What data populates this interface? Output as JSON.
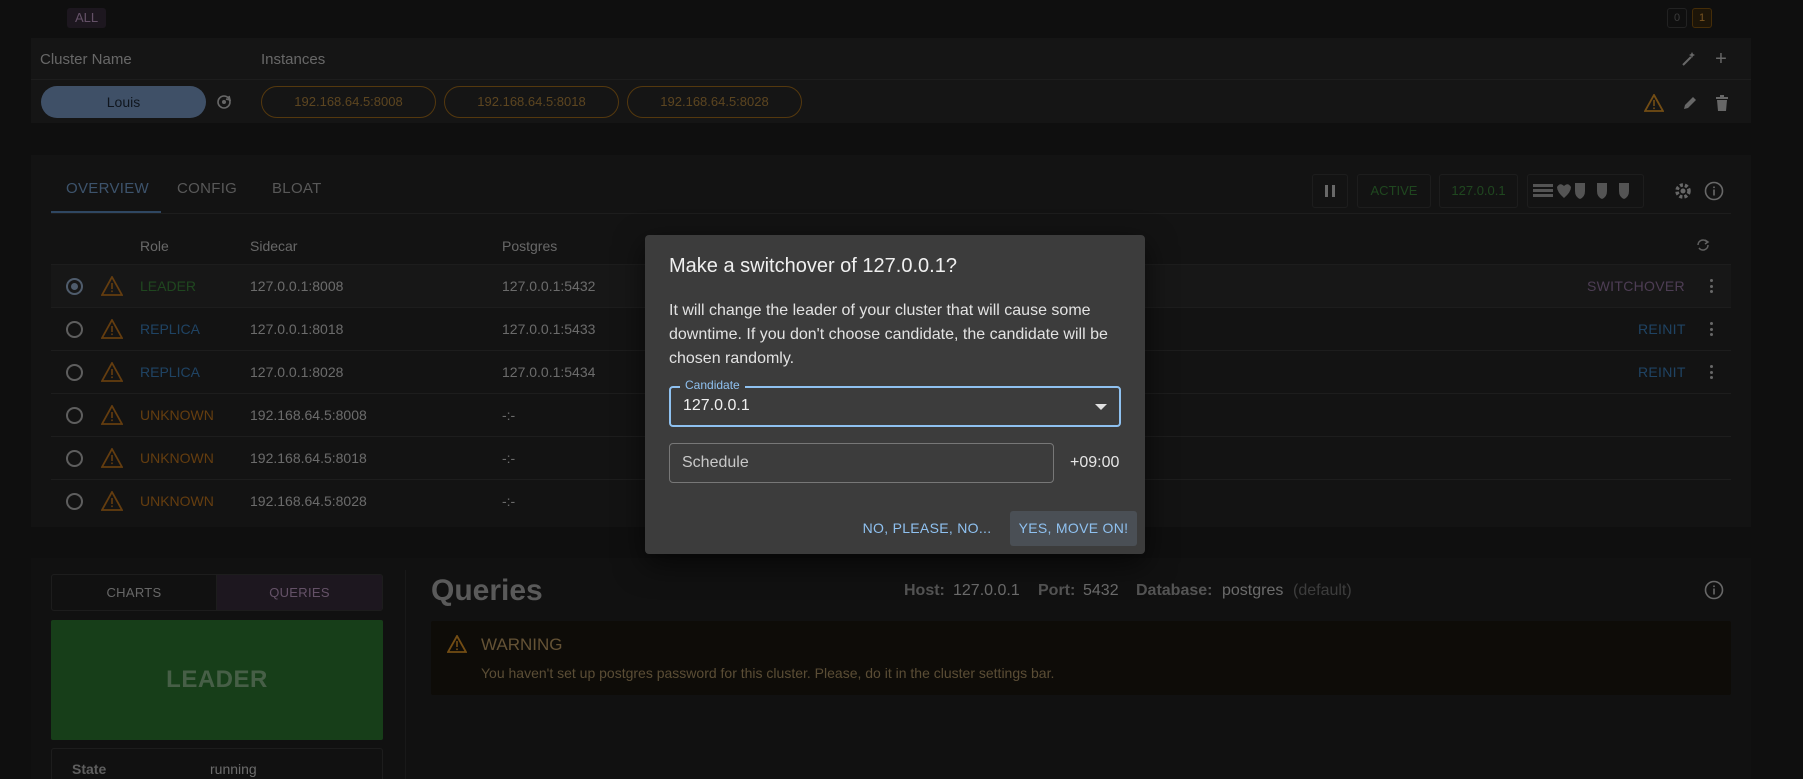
{
  "top": {
    "filter_tag": "ALL",
    "count_a": "0",
    "count_b": "1"
  },
  "clusters": {
    "headers": {
      "name": "Cluster Name",
      "instances": "Instances"
    },
    "row": {
      "name": "Louis",
      "instances": [
        "192.168.64.5:8008",
        "192.168.64.5:8018",
        "192.168.64.5:8028"
      ]
    }
  },
  "panel": {
    "tabs": [
      "OVERVIEW",
      "CONFIG",
      "BLOAT"
    ],
    "active_tab": "OVERVIEW",
    "status": "ACTIVE",
    "host": "127.0.0.1",
    "columns": {
      "role": "Role",
      "sidecar": "Sidecar",
      "postgres": "Postgres"
    },
    "rows": [
      {
        "role": "LEADER",
        "sidecar": "127.0.0.1:8008",
        "postgres": "127.0.0.1:5432",
        "action": "SWITCHOVER",
        "selected": true
      },
      {
        "role": "REPLICA",
        "sidecar": "127.0.0.1:8018",
        "postgres": "127.0.0.1:5433",
        "action": "REINIT"
      },
      {
        "role": "REPLICA",
        "sidecar": "127.0.0.1:8028",
        "postgres": "127.0.0.1:5434",
        "action": "REINIT"
      },
      {
        "role": "UNKNOWN",
        "sidecar": "192.168.64.5:8008",
        "postgres": "-:-",
        "action": ""
      },
      {
        "role": "UNKNOWN",
        "sidecar": "192.168.64.5:8018",
        "postgres": "-:-",
        "action": ""
      },
      {
        "role": "UNKNOWN",
        "sidecar": "192.168.64.5:8028",
        "postgres": "-:-",
        "action": ""
      }
    ]
  },
  "bottom": {
    "side_tabs": [
      "CHARTS",
      "QUERIES"
    ],
    "active_side_tab": "QUERIES",
    "role_box": "LEADER",
    "state_label": "State",
    "state_value": "running",
    "title": "Queries",
    "host_label": "Host:",
    "host_value": "127.0.0.1",
    "port_label": "Port:",
    "port_value": "5432",
    "db_label": "Database:",
    "db_value": "postgres",
    "db_note": "(default)",
    "warning_title": "WARNING",
    "warning_text": "You haven't set up postgres password for this cluster. Please, do it in the cluster settings bar."
  },
  "dialog": {
    "title": "Make a switchover of 127.0.0.1?",
    "body": "It will change the leader of your cluster that will cause some downtime. If you don't choose candidate, the candidate will be chosen randomly.",
    "candidate_label": "Candidate",
    "candidate_value": "127.0.0.1",
    "schedule_placeholder": "Schedule",
    "timezone": "+09:00",
    "cancel": "NO, PLEASE, NO...",
    "confirm": "YES, MOVE ON!"
  },
  "colors": {
    "accent": "#7aa7d8",
    "leader": "#3f8f3f",
    "replica": "#3f86c7",
    "unknown": "#c97a1e",
    "leader_box": "#2e7d32",
    "warning": "#f0a840"
  },
  "icons": [
    "magic-wand-icon",
    "plus-icon",
    "refresh-icon",
    "warning-icon",
    "pencil-icon",
    "trash-icon",
    "pause-icon",
    "gear-icon",
    "info-icon",
    "kebab-icon",
    "caret-down-icon"
  ]
}
